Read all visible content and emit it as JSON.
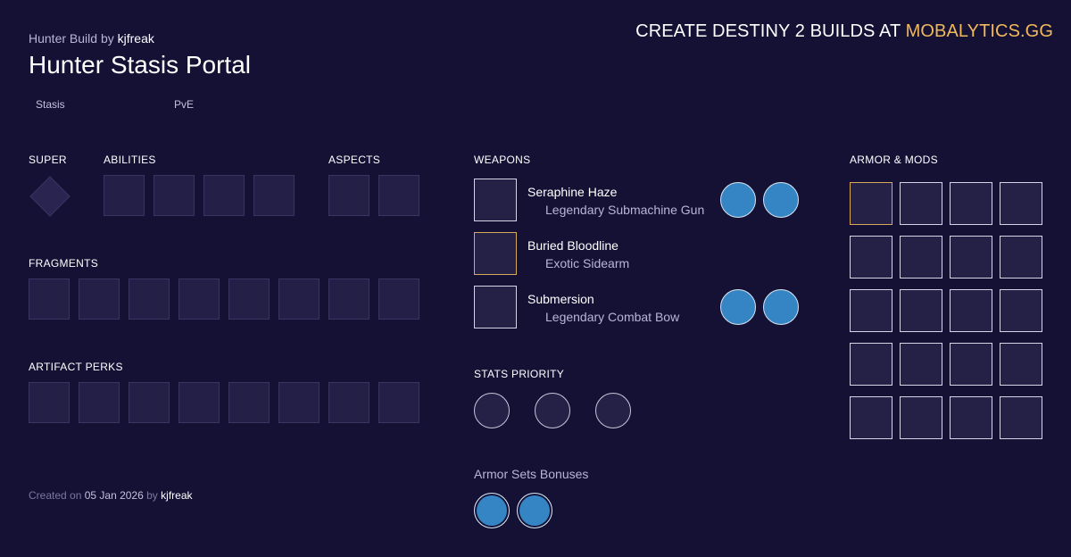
{
  "header": {
    "build_type": "Hunter Build",
    "by": "by",
    "author": "kjfreak",
    "title": "Hunter Stasis Portal",
    "tags": [
      "Stasis",
      "PvE"
    ]
  },
  "promo": {
    "text": "CREATE DESTINY 2 BUILDS AT",
    "brand": "MOBALYTICS.GG"
  },
  "sections": {
    "super": "SUPER",
    "abilities": "ABILITIES",
    "aspects": "ASPECTS",
    "fragments": "FRAGMENTS",
    "artifact_perks": "ARTIFACT PERKS",
    "weapons": "WEAPONS",
    "stats_priority": "STATS PRIORITY",
    "armor_sets": "Armor Sets Bonuses",
    "armor_mods": "ARMOR & MODS"
  },
  "weapons": [
    {
      "name": "Seraphine Haze",
      "type": "Legendary Submachine Gun",
      "rarity": "legendary",
      "perk_count": 2
    },
    {
      "name": "Buried Bloodline",
      "type": "Exotic Sidearm",
      "rarity": "exotic",
      "perk_count": 0
    },
    {
      "name": "Submersion",
      "type": "Legendary Combat Bow",
      "rarity": "legendary",
      "perk_count": 2
    }
  ],
  "footer": {
    "created_on": "Created on",
    "date": "05 Jan 2026",
    "by": "by",
    "author": "kjfreak"
  },
  "colors": {
    "background": "#151135",
    "accent": "#f0b95b",
    "perk_blue": "#3585c5",
    "exotic_border": "#d9a85a"
  },
  "icons": {
    "super": "super-diamond-icon",
    "perk": "weapon-perk-icon",
    "stat": "stat-icon",
    "armor_set": "armor-set-icon"
  }
}
